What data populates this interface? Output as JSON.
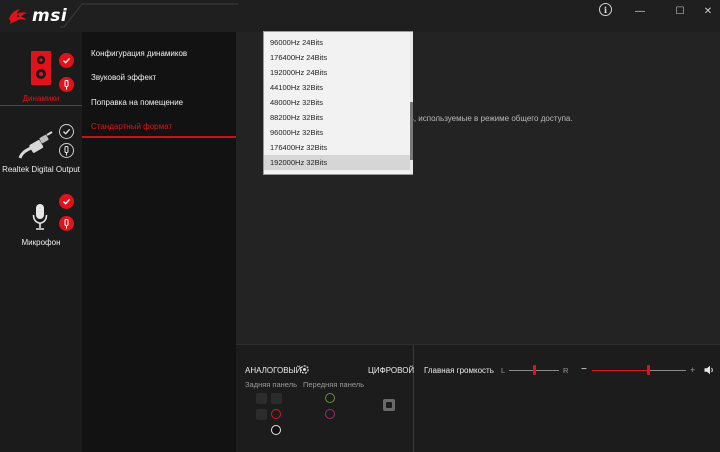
{
  "window": {
    "logo": "msi",
    "info_glyph": "i",
    "minimize_glyph": "—",
    "maximize_glyph": "☐",
    "close_glyph": "✕"
  },
  "devices": [
    {
      "label": "Динамики",
      "icon": "speaker-icon",
      "badge_top": "check-icon",
      "badge_bottom": "jack-icon",
      "active": true
    },
    {
      "label": "Realtek Digital Output",
      "icon": "digital-cable-icon",
      "badge_top": "check-icon",
      "badge_bottom": "jack-icon",
      "active": false
    },
    {
      "label": "Микрофон",
      "icon": "microphone-icon",
      "badge_top": "check-icon",
      "badge_bottom": "jack-icon",
      "active": false
    }
  ],
  "menu": {
    "items": [
      "Конфигурация динамиков",
      "Звуковой эффект",
      "Поправка на помещение",
      "Стандартный формат"
    ],
    "active_index": 3
  },
  "content": {
    "description": "сть, используемые в режиме общего доступа."
  },
  "format_dropdown": {
    "options": [
      "96000Hz 24Bits",
      "176400Hz 24Bits",
      "192000Hz 24Bits",
      "44100Hz 32Bits",
      "48000Hz 32Bits",
      "88200Hz 32Bits",
      "96000Hz 32Bits",
      "176400Hz 32Bits",
      "192000Hz 32Bits"
    ],
    "selected": "192000Hz 32Bits"
  },
  "bottom": {
    "analog_title": "АНАЛОГОВЫЙ",
    "digital_title": "ЦИФРОВОЙ",
    "rear_panel": "Задняя панель",
    "front_panel": "Передняя панель",
    "master_volume": "Главная громкость",
    "balance_left": "L",
    "balance_right": "R",
    "volume_minus": "−",
    "volume_plus": "+",
    "balance_value": 0.5,
    "volume_value": 0.6
  },
  "colors": {
    "accent_red": "#e2121b",
    "jack_green": "#6f8a3a",
    "jack_pink": "#a02a66"
  }
}
